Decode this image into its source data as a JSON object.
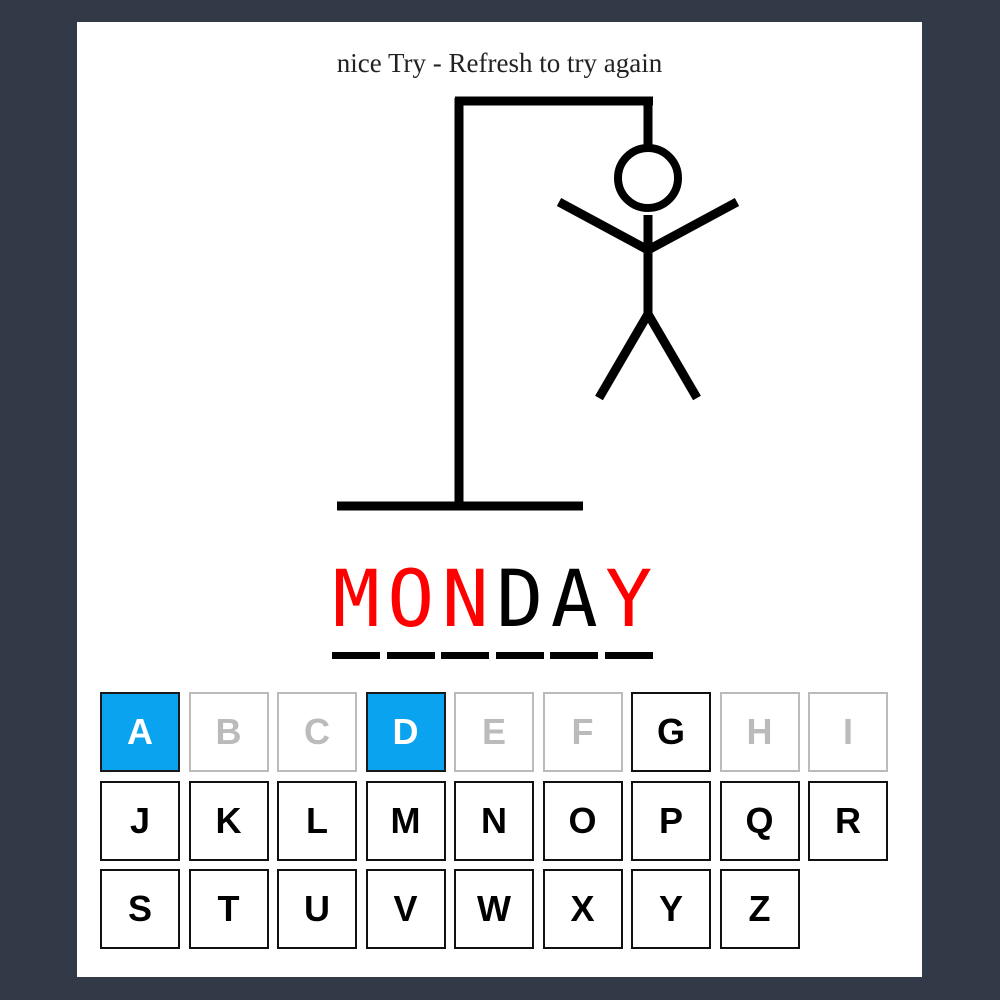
{
  "status_message": "nice Try - Refresh to try again",
  "word": [
    {
      "letter": "M",
      "color": "#ff0000"
    },
    {
      "letter": "O",
      "color": "#ff0000"
    },
    {
      "letter": "N",
      "color": "#ff0000"
    },
    {
      "letter": "D",
      "color": "#000000"
    },
    {
      "letter": "A",
      "color": "#000000"
    },
    {
      "letter": "Y",
      "color": "#ff0000"
    }
  ],
  "keyboard": [
    {
      "label": "A",
      "state": "hit"
    },
    {
      "label": "B",
      "state": "used"
    },
    {
      "label": "C",
      "state": "used"
    },
    {
      "label": "D",
      "state": "hit"
    },
    {
      "label": "E",
      "state": "used"
    },
    {
      "label": "F",
      "state": "used"
    },
    {
      "label": "G",
      "state": "available"
    },
    {
      "label": "H",
      "state": "used"
    },
    {
      "label": "I",
      "state": "used"
    },
    {
      "label": "J",
      "state": "available"
    },
    {
      "label": "K",
      "state": "available"
    },
    {
      "label": "L",
      "state": "available"
    },
    {
      "label": "M",
      "state": "available"
    },
    {
      "label": "N",
      "state": "available"
    },
    {
      "label": "O",
      "state": "available"
    },
    {
      "label": "P",
      "state": "available"
    },
    {
      "label": "Q",
      "state": "available"
    },
    {
      "label": "R",
      "state": "available"
    },
    {
      "label": "S",
      "state": "available"
    },
    {
      "label": "T",
      "state": "available"
    },
    {
      "label": "U",
      "state": "available"
    },
    {
      "label": "V",
      "state": "available"
    },
    {
      "label": "W",
      "state": "available"
    },
    {
      "label": "X",
      "state": "available"
    },
    {
      "label": "Y",
      "state": "available"
    },
    {
      "label": "Z",
      "state": "available"
    }
  ],
  "colors": {
    "hit": "#0aa3ef",
    "missed_letter": "#ff0000",
    "used_key": "#bbbbbb",
    "background": "#333a47"
  }
}
